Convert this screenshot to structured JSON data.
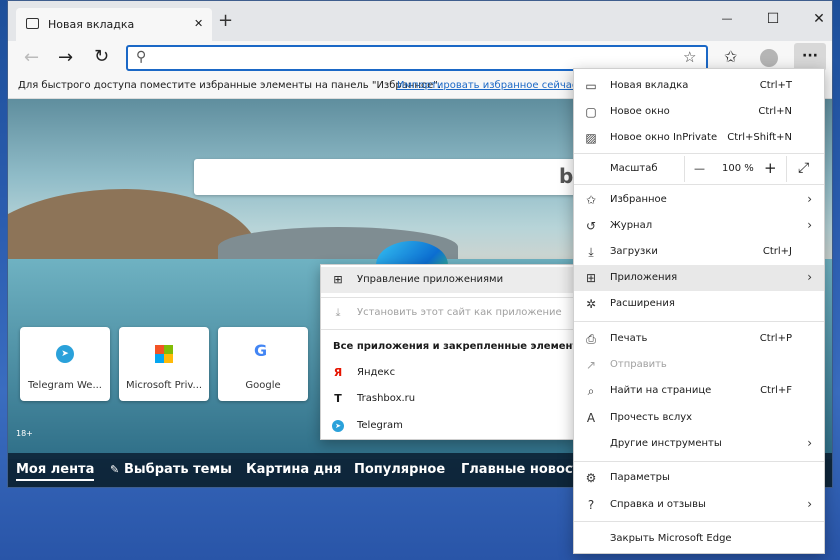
{
  "tab": {
    "title": "Новая вкладка",
    "close": "✕",
    "new": "+"
  },
  "window": {
    "minimize": "—",
    "maximize": "☐",
    "close": "✕"
  },
  "toolbar": {
    "address": "",
    "more": "···"
  },
  "favbar": {
    "hint": "Для быстрого доступа поместите избранные элементы на панель \"Избранное\".",
    "import": "Импортировать избранное сейчас"
  },
  "tiles": [
    {
      "label": "Telegram We..."
    },
    {
      "label": "Microsoft Priv..."
    },
    {
      "label": "Google"
    }
  ],
  "age": "18+",
  "news": [
    "Моя лента",
    "Выбрать темы",
    "Картина дня",
    "Популярное",
    "Главные новости"
  ],
  "menu": {
    "new_tab": {
      "label": "Новая вкладка",
      "shortcut": "Ctrl+T"
    },
    "new_window": {
      "label": "Новое окно",
      "shortcut": "Ctrl+N"
    },
    "inprivate": {
      "label": "Новое окно InPrivate",
      "shortcut": "Ctrl+Shift+N"
    },
    "zoom": {
      "label": "Масштаб",
      "minus": "—",
      "value": "100 %",
      "plus": "+"
    },
    "favorites": {
      "label": "Избранное"
    },
    "history": {
      "label": "Журнал"
    },
    "downloads": {
      "label": "Загрузки",
      "shortcut": "Ctrl+J"
    },
    "apps": {
      "label": "Приложения"
    },
    "extensions": {
      "label": "Расширения"
    },
    "print": {
      "label": "Печать",
      "shortcut": "Ctrl+P"
    },
    "share": {
      "label": "Отправить"
    },
    "find": {
      "label": "Найти на странице",
      "shortcut": "Ctrl+F"
    },
    "read_aloud": {
      "label": "Прочесть вслух"
    },
    "more_tools": {
      "label": "Другие инструменты"
    },
    "settings": {
      "label": "Параметры"
    },
    "help": {
      "label": "Справка и отзывы"
    },
    "close": {
      "label": "Закрыть Microsoft Edge"
    }
  },
  "apps_menu": {
    "manage": "Управление приложениями",
    "install": "Установить этот сайт как приложение",
    "section": "Все приложения и закрепленные элементы",
    "items": [
      "Яндекс",
      "Trashbox.ru",
      "Telegram"
    ]
  },
  "colors": {
    "accent": "#1b68c6",
    "disabled": "#a0a0a0"
  }
}
